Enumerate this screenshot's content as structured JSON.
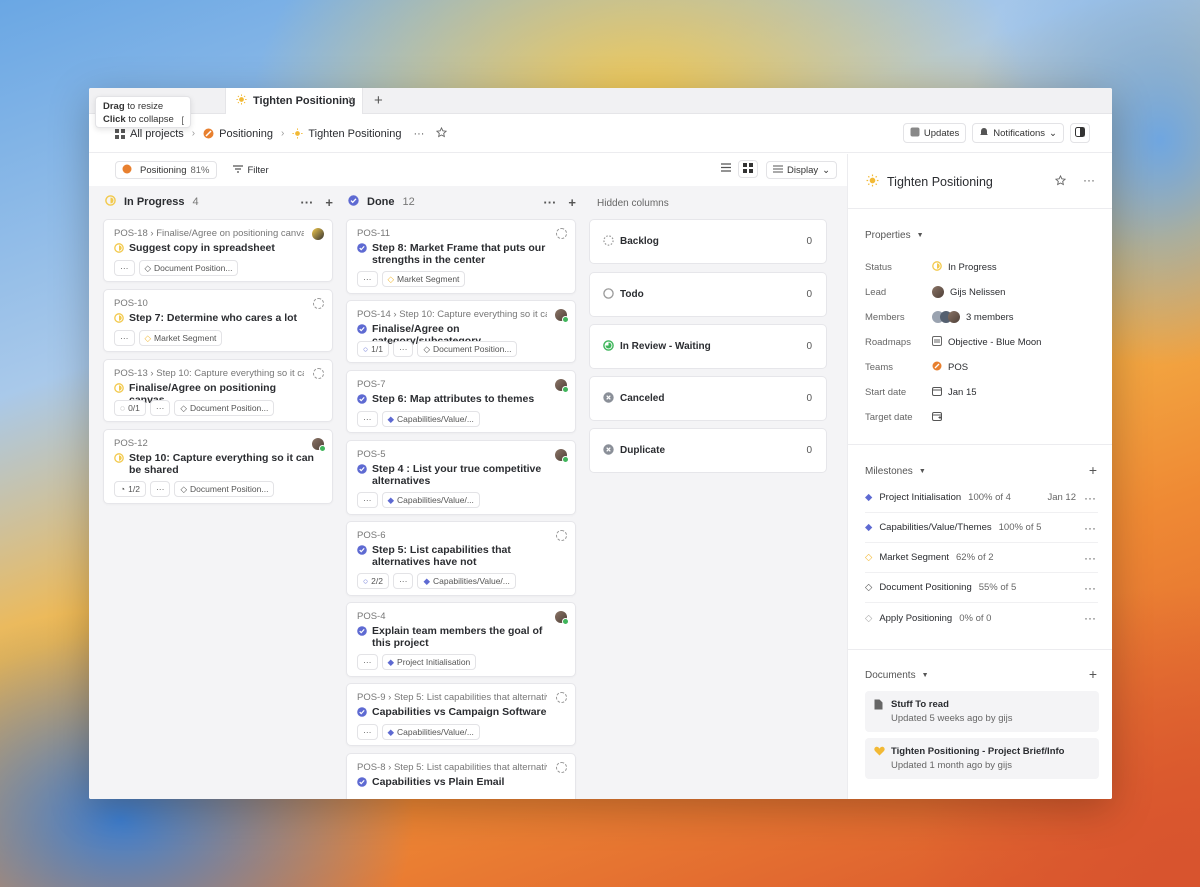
{
  "tab": {
    "title": "Tighten Positioning",
    "close": "×",
    "new": "+"
  },
  "tooltip": {
    "drag": "Drag",
    "drag_rest": "to resize",
    "click": "Click",
    "click_rest": "to collapse",
    "key": "["
  },
  "breadcrumb": {
    "all": "All projects",
    "project": "Positioning",
    "current": "Tighten Positioning",
    "more": "···"
  },
  "header": {
    "updates": "Updates",
    "notifications": "Notifications"
  },
  "toolbar": {
    "chip_label": "Positioning",
    "chip_pct": "81%",
    "filter": "Filter",
    "display": "Display"
  },
  "columns": {
    "in_progress": {
      "title": "In Progress",
      "count": "4"
    },
    "done": {
      "title": "Done",
      "count": "12"
    },
    "hidden_title": "Hidden columns"
  },
  "in_progress_cards": [
    {
      "id": "POS-18",
      "parent": "Finalise/Agree on positioning canvas...",
      "title": "Suggest copy in spreadsheet",
      "tag": "Document Position...",
      "progress": ""
    },
    {
      "id": "POS-10",
      "parent": "",
      "title": "Step 7: Determine who cares a lot",
      "tag": "Market Segment",
      "progress": ""
    },
    {
      "id": "POS-13",
      "parent": "Step 10: Capture everything so it ca...",
      "title": "Finalise/Agree on positioning canvas",
      "tag": "Document Position...",
      "progress": "0/1"
    },
    {
      "id": "POS-12",
      "parent": "",
      "title": "Step 10: Capture everything so it can be shared",
      "tag": "Document Position...",
      "progress": "1/2"
    }
  ],
  "done_cards": [
    {
      "id": "POS-11",
      "parent": "",
      "title": "Step 8: Market Frame that puts our strengths in the center",
      "tag": "Market Segment",
      "progress": ""
    },
    {
      "id": "POS-14",
      "parent": "Step 10: Capture everything so it ca...",
      "title": "Finalise/Agree on category/subcategory",
      "tag": "Document Position...",
      "progress": "1/1"
    },
    {
      "id": "POS-7",
      "parent": "",
      "title": "Step 6: Map attributes to themes",
      "tag": "Capabilities/Value/...",
      "progress": ""
    },
    {
      "id": "POS-5",
      "parent": "",
      "title": "Step 4 : List your true competitive alternatives",
      "tag": "Capabilities/Value/...",
      "progress": ""
    },
    {
      "id": "POS-6",
      "parent": "",
      "title": "Step 5: List capabilities that alternatives have not",
      "tag": "Capabilities/Value/...",
      "progress": "2/2"
    },
    {
      "id": "POS-4",
      "parent": "",
      "title": "Explain team members the goal of this project",
      "tag": "Project Initialisation",
      "progress": ""
    },
    {
      "id": "POS-9",
      "parent": "Step 5: List capabilities that alternativ...",
      "title": "Capabilities vs Campaign Software",
      "tag": "Capabilities/Value/...",
      "progress": ""
    },
    {
      "id": "POS-8",
      "parent": "Step 5: List capabilities that alternativ...",
      "title": "Capabilities vs Plain Email",
      "tag": "",
      "progress": ""
    }
  ],
  "hidden_columns": [
    {
      "name": "Backlog",
      "count": "0"
    },
    {
      "name": "Todo",
      "count": "0"
    },
    {
      "name": "In Review - Waiting",
      "count": "0"
    },
    {
      "name": "Canceled",
      "count": "0"
    },
    {
      "name": "Duplicate",
      "count": "0"
    }
  ],
  "panel": {
    "title": "Tighten Positioning",
    "properties_label": "Properties",
    "props": {
      "status_k": "Status",
      "status_v": "In Progress",
      "lead_k": "Lead",
      "lead_v": "Gijs Nelissen",
      "members_k": "Members",
      "members_v": "3 members",
      "roadmaps_k": "Roadmaps",
      "roadmaps_v": "Objective - Blue Moon",
      "teams_k": "Teams",
      "teams_v": "POS",
      "start_k": "Start date",
      "start_v": "Jan 15",
      "target_k": "Target date"
    },
    "milestones_label": "Milestones",
    "milestones": [
      {
        "name": "Project Initialisation",
        "pct": "100% of 4",
        "date": "Jan 12"
      },
      {
        "name": "Capabilities/Value/Themes",
        "pct": "100% of 5",
        "date": ""
      },
      {
        "name": "Market Segment",
        "pct": "62% of 2",
        "date": ""
      },
      {
        "name": "Document Positioning",
        "pct": "55% of 5",
        "date": ""
      },
      {
        "name": "Apply Positioning",
        "pct": "0% of 0",
        "date": ""
      }
    ],
    "documents_label": "Documents",
    "documents": [
      {
        "title": "Stuff To read",
        "sub": "Updated 5 weeks ago by gijs"
      },
      {
        "title": "Tighten Positioning - Project Brief/Info",
        "sub": "Updated 1 month ago by gijs"
      }
    ]
  },
  "colors": {
    "accent": "#5e6ad2",
    "in_progress": "#f2c94c",
    "done": "#5e6ad2",
    "green": "#3fb55b"
  }
}
